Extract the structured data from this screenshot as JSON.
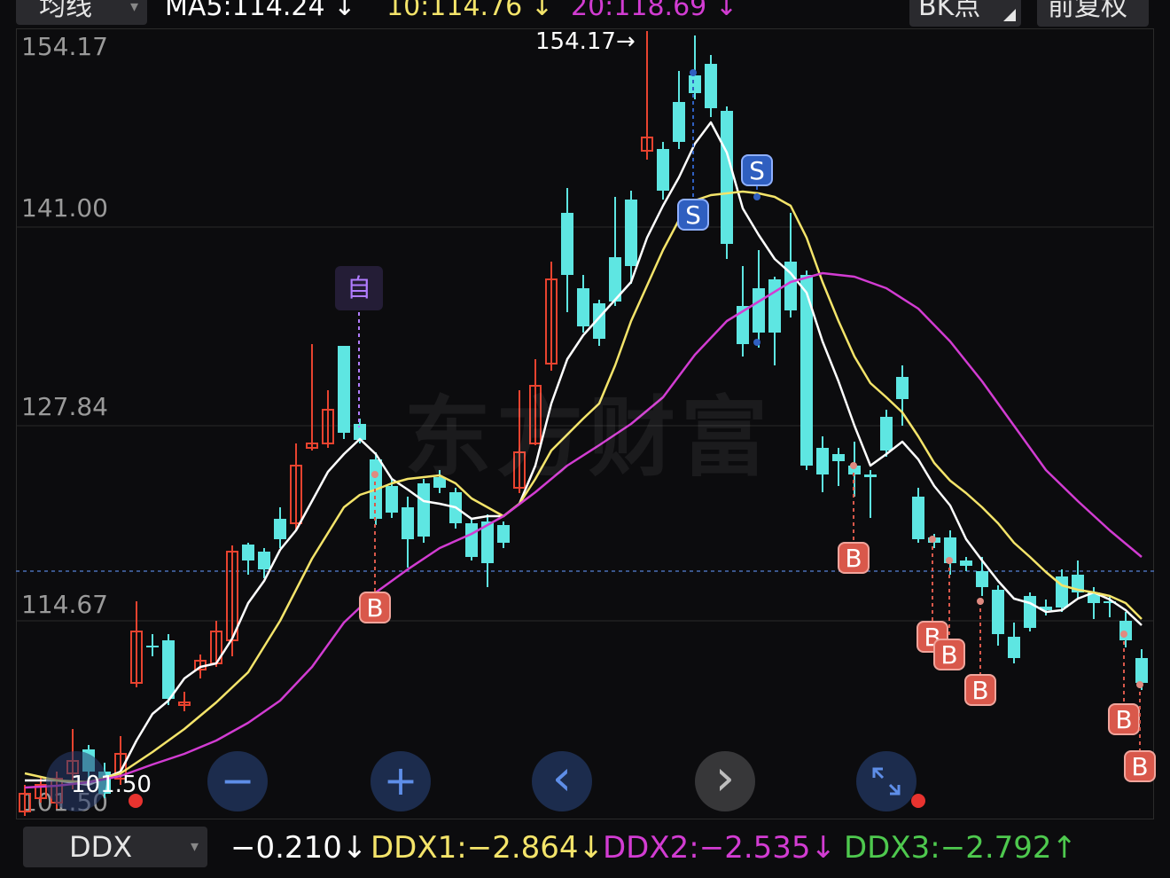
{
  "header": {
    "indicator_select": {
      "label": "均线",
      "caret": "▾"
    },
    "ma5": {
      "text": "MA5:114.24",
      "arrow": "↓",
      "color": "#ffffff"
    },
    "ma10": {
      "text": "10:114.76",
      "arrow": "↓",
      "color": "#f4e46a"
    },
    "ma20": {
      "text": "20:118.69",
      "arrow": "↓",
      "color": "#d23cd2"
    },
    "bk_button": "BK点",
    "adjust_button": "前复权"
  },
  "chart": {
    "y_labels": [
      "154.17",
      "141.00",
      "127.84",
      "114.67",
      "101.50"
    ],
    "max_marker": "154.17→",
    "overlay_label": "101.50",
    "watermark": "东方财富",
    "self_tag": "自",
    "buy_tag": "B",
    "sell_tag": "S",
    "colors": {
      "up": "#e8432f",
      "down": "#5ee6e2",
      "ma5": "#ffffff",
      "ma10": "#f4e46a",
      "ma20": "#d23cd2",
      "buy": "#d9584b",
      "sell": "#2f5fc0"
    }
  },
  "controls": {
    "zoom_out": "−",
    "zoom_in": "+",
    "prev": "‹",
    "next": "›"
  },
  "footer": {
    "indicator_select": {
      "label": "DDX",
      "caret": "▾"
    },
    "ddx": {
      "text": "−0.210",
      "arrow": "↓",
      "color": "#ffffff"
    },
    "ddx1": {
      "text": "DDX1:−2.864",
      "arrow": "↓",
      "color": "#f4e46a"
    },
    "ddx2": {
      "text": "DDX2:−2.535",
      "arrow": "↓",
      "color": "#d23cd2"
    },
    "ddx3": {
      "text": "DDX3:−2.792",
      "arrow": "↑",
      "color": "#4ec94e"
    }
  }
}
